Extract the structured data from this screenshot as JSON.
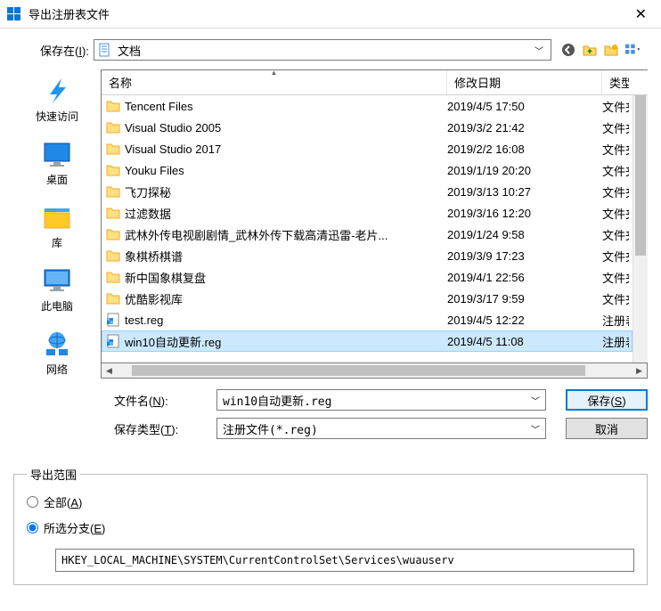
{
  "window": {
    "title": "导出注册表文件"
  },
  "save_in": {
    "label_pre": "保存在(",
    "label_u": "I",
    "label_post": "):",
    "value": "文档"
  },
  "columns": {
    "name": "名称",
    "date": "修改日期",
    "type": "类型"
  },
  "sidebar": [
    {
      "label": "快速访问"
    },
    {
      "label": "桌面"
    },
    {
      "label": "库"
    },
    {
      "label": "此电脑"
    },
    {
      "label": "网络"
    }
  ],
  "files": [
    {
      "name": "Tencent Files",
      "date": "2019/4/5 17:50",
      "type": "文件夹",
      "icon": "folder"
    },
    {
      "name": "Visual Studio 2005",
      "date": "2019/3/2 21:42",
      "type": "文件夹",
      "icon": "folder"
    },
    {
      "name": "Visual Studio 2017",
      "date": "2019/2/2 16:08",
      "type": "文件夹",
      "icon": "folder"
    },
    {
      "name": "Youku Files",
      "date": "2019/1/19 20:20",
      "type": "文件夹",
      "icon": "folder"
    },
    {
      "name": "飞刀探秘",
      "date": "2019/3/13 10:27",
      "type": "文件夹",
      "icon": "folder"
    },
    {
      "name": "过滤数据",
      "date": "2019/3/16 12:20",
      "type": "文件夹",
      "icon": "folder"
    },
    {
      "name": "武林外传电视剧剧情_武林外传下载高清迅雷-老片...",
      "date": "2019/1/24 9:58",
      "type": "文件夹",
      "icon": "folder"
    },
    {
      "name": "象棋桥棋谱",
      "date": "2019/3/9 17:23",
      "type": "文件夹",
      "icon": "folder"
    },
    {
      "name": "新中国象棋复盘",
      "date": "2019/4/1 22:56",
      "type": "文件夹",
      "icon": "folder"
    },
    {
      "name": "优酷影视库",
      "date": "2019/3/17 9:59",
      "type": "文件夹",
      "icon": "folder"
    },
    {
      "name": "test.reg",
      "date": "2019/4/5 12:22",
      "type": "注册表项",
      "icon": "reg"
    },
    {
      "name": "win10自动更新.reg",
      "date": "2019/4/5 11:08",
      "type": "注册表项",
      "icon": "reg",
      "selected": true
    }
  ],
  "filename": {
    "label_pre": "文件名(",
    "label_u": "N",
    "label_post": "):",
    "value": "win10自动更新.reg"
  },
  "filetype": {
    "label_pre": "保存类型(",
    "label_u": "T",
    "label_post": "):",
    "value": "注册文件(*.reg)"
  },
  "buttons": {
    "save_pre": "保存(",
    "save_u": "S",
    "save_post": ")",
    "cancel": "取消"
  },
  "export_range": {
    "legend": "导出范围",
    "all_pre": "全部(",
    "all_u": "A",
    "all_post": ")",
    "branch_pre": "所选分支(",
    "branch_u": "E",
    "branch_post": ")",
    "branch_value": "HKEY_LOCAL_MACHINE\\SYSTEM\\CurrentControlSet\\Services\\wuauserv"
  }
}
